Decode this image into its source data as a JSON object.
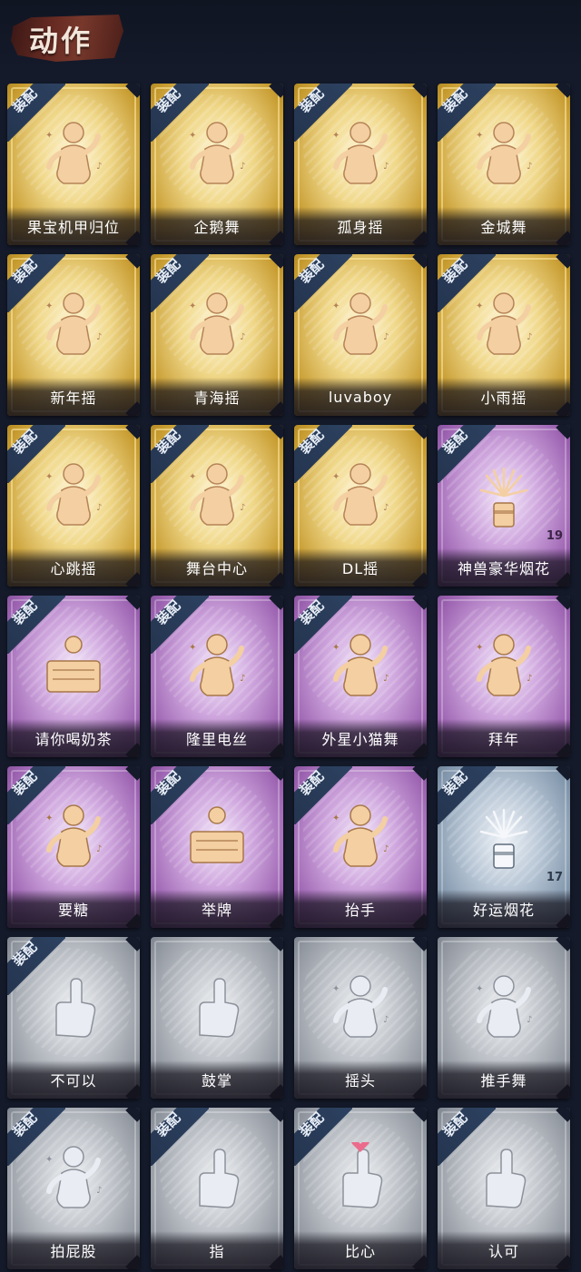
{
  "header": {
    "title": "动作"
  },
  "equip_badge": "装配",
  "cards": [
    {
      "label": "果宝机甲归位",
      "tier": "gold",
      "equipped": true,
      "icon": "dance-pose-icon"
    },
    {
      "label": "企鹅舞",
      "tier": "gold",
      "equipped": true,
      "icon": "dance-pose-icon"
    },
    {
      "label": "孤身摇",
      "tier": "gold",
      "equipped": true,
      "icon": "dance-pose-icon"
    },
    {
      "label": "金城舞",
      "tier": "gold",
      "equipped": true,
      "icon": "dance-pose-icon"
    },
    {
      "label": "新年摇",
      "tier": "gold",
      "equipped": true,
      "icon": "dance-pose-icon"
    },
    {
      "label": "青海摇",
      "tier": "gold",
      "equipped": true,
      "icon": "dance-pose-icon"
    },
    {
      "label": "luvaboy",
      "tier": "gold",
      "equipped": true,
      "icon": "dance-pose-icon"
    },
    {
      "label": "小雨摇",
      "tier": "gold",
      "equipped": true,
      "icon": "dance-pose-icon"
    },
    {
      "label": "心跳摇",
      "tier": "gold",
      "equipped": true,
      "icon": "dance-pose-icon"
    },
    {
      "label": "舞台中心",
      "tier": "gold",
      "equipped": true,
      "icon": "dance-pose-icon"
    },
    {
      "label": "DL摇",
      "tier": "gold",
      "equipped": true,
      "icon": "dance-pose-icon"
    },
    {
      "label": "神兽豪华烟花",
      "tier": "purple",
      "equipped": true,
      "icon": "fireworks-icon",
      "count": "19"
    },
    {
      "label": "请你喝奶茶",
      "tier": "purple",
      "equipped": true,
      "icon": "milk-tea-icon"
    },
    {
      "label": "隆里电丝",
      "tier": "purple",
      "equipped": true,
      "icon": "dance-pose-icon"
    },
    {
      "label": "外星小猫舞",
      "tier": "purple",
      "equipped": true,
      "icon": "dance-pose-icon"
    },
    {
      "label": "拜年",
      "tier": "purple",
      "equipped": false,
      "icon": "bow-greeting-icon"
    },
    {
      "label": "要糖",
      "tier": "purple",
      "equipped": true,
      "icon": "ask-candy-icon"
    },
    {
      "label": "举牌",
      "tier": "purple",
      "equipped": true,
      "icon": "hold-sign-icon"
    },
    {
      "label": "抬手",
      "tier": "purple",
      "equipped": true,
      "icon": "raise-hand-icon"
    },
    {
      "label": "好运烟花",
      "tier": "blue",
      "equipped": true,
      "icon": "firework-can-icon",
      "count": "17"
    },
    {
      "label": "不可以",
      "tier": "gray",
      "equipped": true,
      "icon": "finger-wag-icon"
    },
    {
      "label": "鼓掌",
      "tier": "gray",
      "equipped": false,
      "icon": "clap-icon"
    },
    {
      "label": "摇头",
      "tier": "gray",
      "equipped": false,
      "icon": "shake-head-icon"
    },
    {
      "label": "推手舞",
      "tier": "gray",
      "equipped": false,
      "icon": "push-hand-icon"
    },
    {
      "label": "拍屁股",
      "tier": "gray",
      "equipped": true,
      "icon": "pat-icon"
    },
    {
      "label": "指",
      "tier": "gray",
      "equipped": true,
      "icon": "point-icon"
    },
    {
      "label": "比心",
      "tier": "gray",
      "equipped": true,
      "icon": "finger-heart-icon"
    },
    {
      "label": "认可",
      "tier": "gray",
      "equipped": true,
      "icon": "thumbs-up-icon"
    }
  ]
}
